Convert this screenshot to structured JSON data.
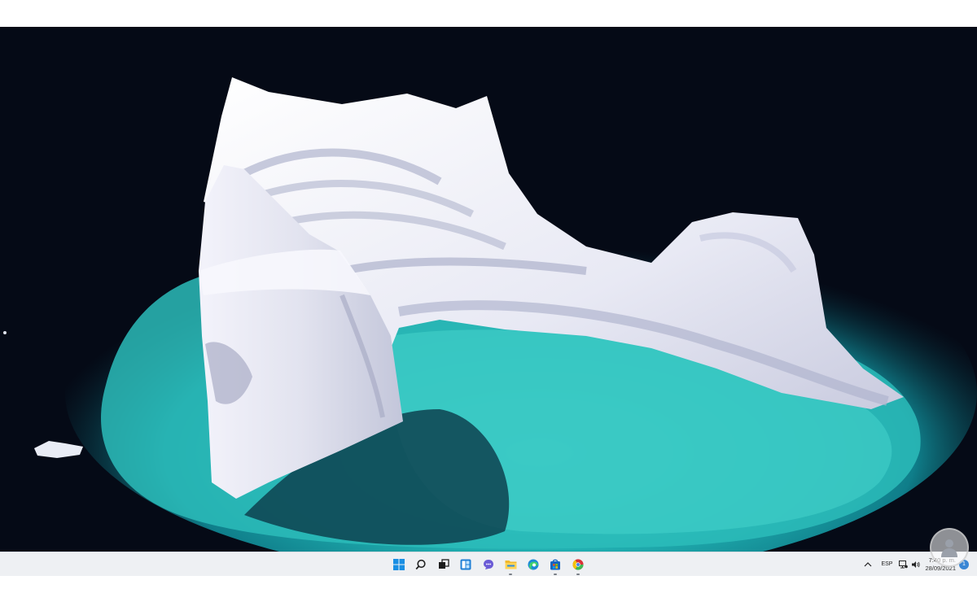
{
  "desktop": {
    "wallpaper": "iceberg-wallpaper"
  },
  "taskbar": {
    "apps": [
      {
        "name": "start-button",
        "icon": "windows-logo-icon"
      },
      {
        "name": "search-button",
        "icon": "search-icon"
      },
      {
        "name": "task-view-button",
        "icon": "task-view-icon"
      },
      {
        "name": "widgets-button",
        "icon": "widgets-icon"
      },
      {
        "name": "teams-chat-button",
        "icon": "chat-icon"
      },
      {
        "name": "file-explorer-button",
        "icon": "folder-icon",
        "running": true
      },
      {
        "name": "edge-button",
        "icon": "edge-icon"
      },
      {
        "name": "store-button",
        "icon": "store-icon",
        "running": true
      },
      {
        "name": "chromium-button",
        "icon": "chromium-icon",
        "running": true
      }
    ],
    "tray": {
      "language": "ESP",
      "time": "7:40 p. m.",
      "date": "28/09/2021",
      "notifications": "1"
    }
  },
  "colors": {
    "taskbar_bg": "#eef0f3",
    "water_deep": "#050a16",
    "water_turquoise": "#2ec0bd",
    "ice": "#f1f1f8",
    "windows_blue": "#1a8fe3"
  }
}
